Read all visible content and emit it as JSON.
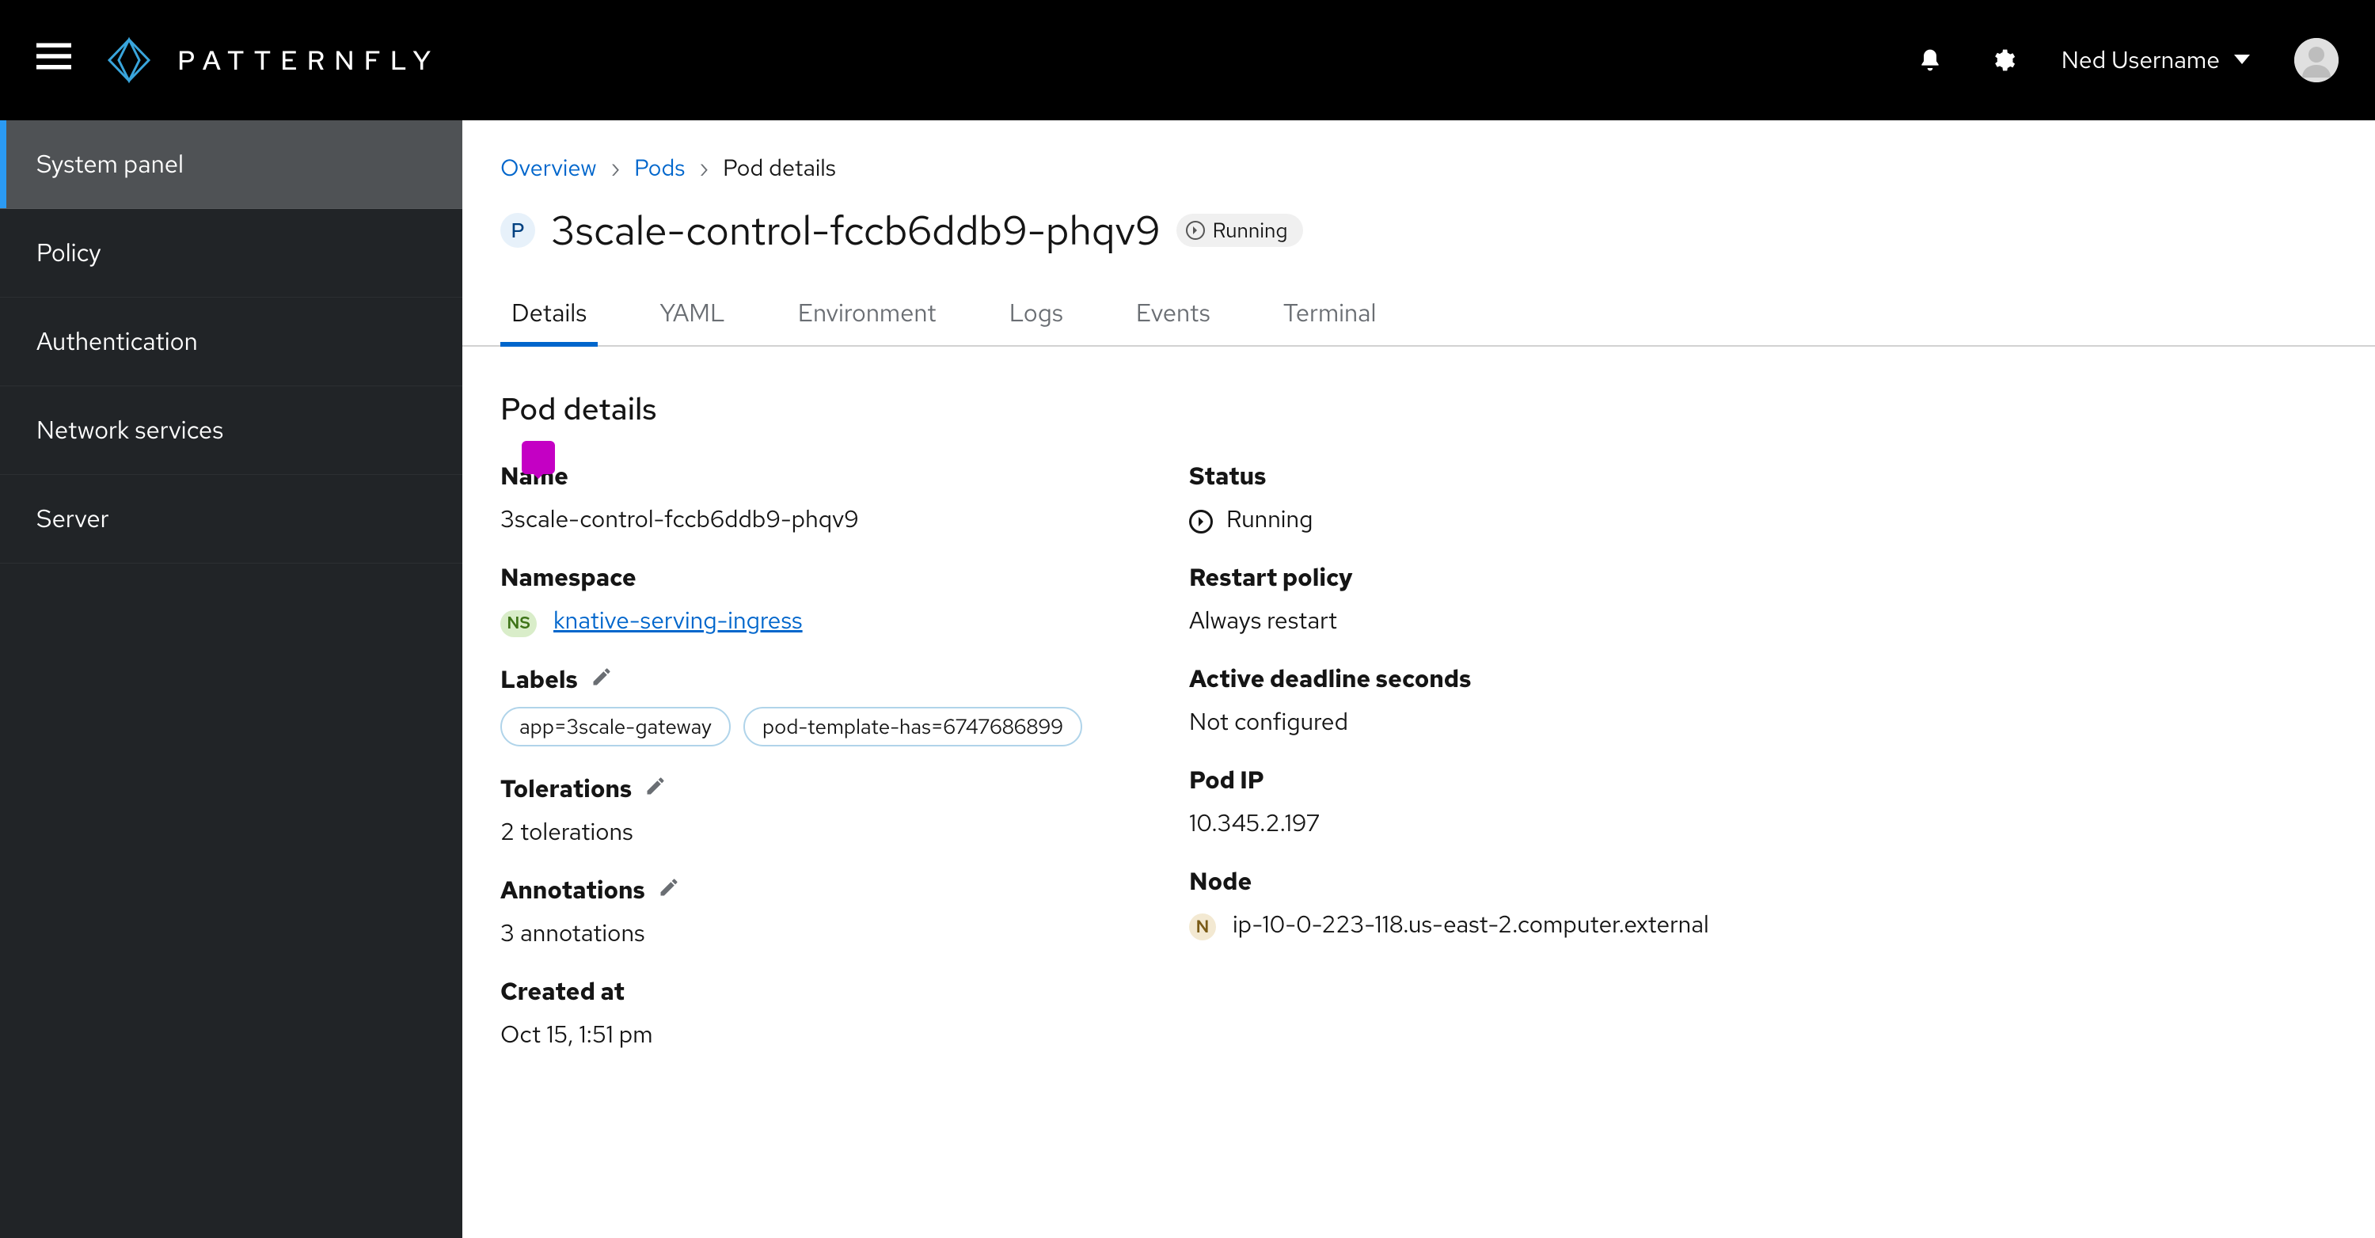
{
  "brand": {
    "name": "PATTERNFLY"
  },
  "header": {
    "username": "Ned Username"
  },
  "sidebar": {
    "items": [
      {
        "label": "System panel",
        "active": true
      },
      {
        "label": "Policy"
      },
      {
        "label": "Authentication"
      },
      {
        "label": "Network services"
      },
      {
        "label": "Server"
      }
    ]
  },
  "breadcrumb": {
    "overview": "Overview",
    "pods": "Pods",
    "current": "Pod details"
  },
  "page": {
    "type_badge": "P",
    "title": "3scale-control-fccb6ddb9-phqv9",
    "status_chip": "Running"
  },
  "tabs": [
    {
      "label": "Details",
      "active": true
    },
    {
      "label": "YAML"
    },
    {
      "label": "Environment"
    },
    {
      "label": "Logs"
    },
    {
      "label": "Events"
    },
    {
      "label": "Terminal"
    }
  ],
  "section_title": "Pod details",
  "left": {
    "name_label": "Name",
    "name_value": "3scale-control-fccb6ddb9-phqv9",
    "namespace_label": "Namespace",
    "namespace_badge": "NS",
    "namespace_value": "knative-serving-ingress",
    "labels_label": "Labels",
    "labels": [
      "app=3scale-gateway",
      "pod-template-has=6747686899"
    ],
    "tolerations_label": "Tolerations",
    "tolerations_value": "2 tolerations",
    "annotations_label": "Annotations",
    "annotations_value": "3 annotations",
    "created_label": "Created at",
    "created_value": "Oct 15, 1:51 pm"
  },
  "right": {
    "status_label": "Status",
    "status_value": "Running",
    "restart_label": "Restart policy",
    "restart_value": "Always restart",
    "deadline_label": "Active deadline seconds",
    "deadline_value": "Not configured",
    "podip_label": "Pod IP",
    "podip_value": "10.345.2.197",
    "node_label": "Node",
    "node_badge": "N",
    "node_value": "ip-10-0-223-118.us-east-2.computer.external"
  }
}
